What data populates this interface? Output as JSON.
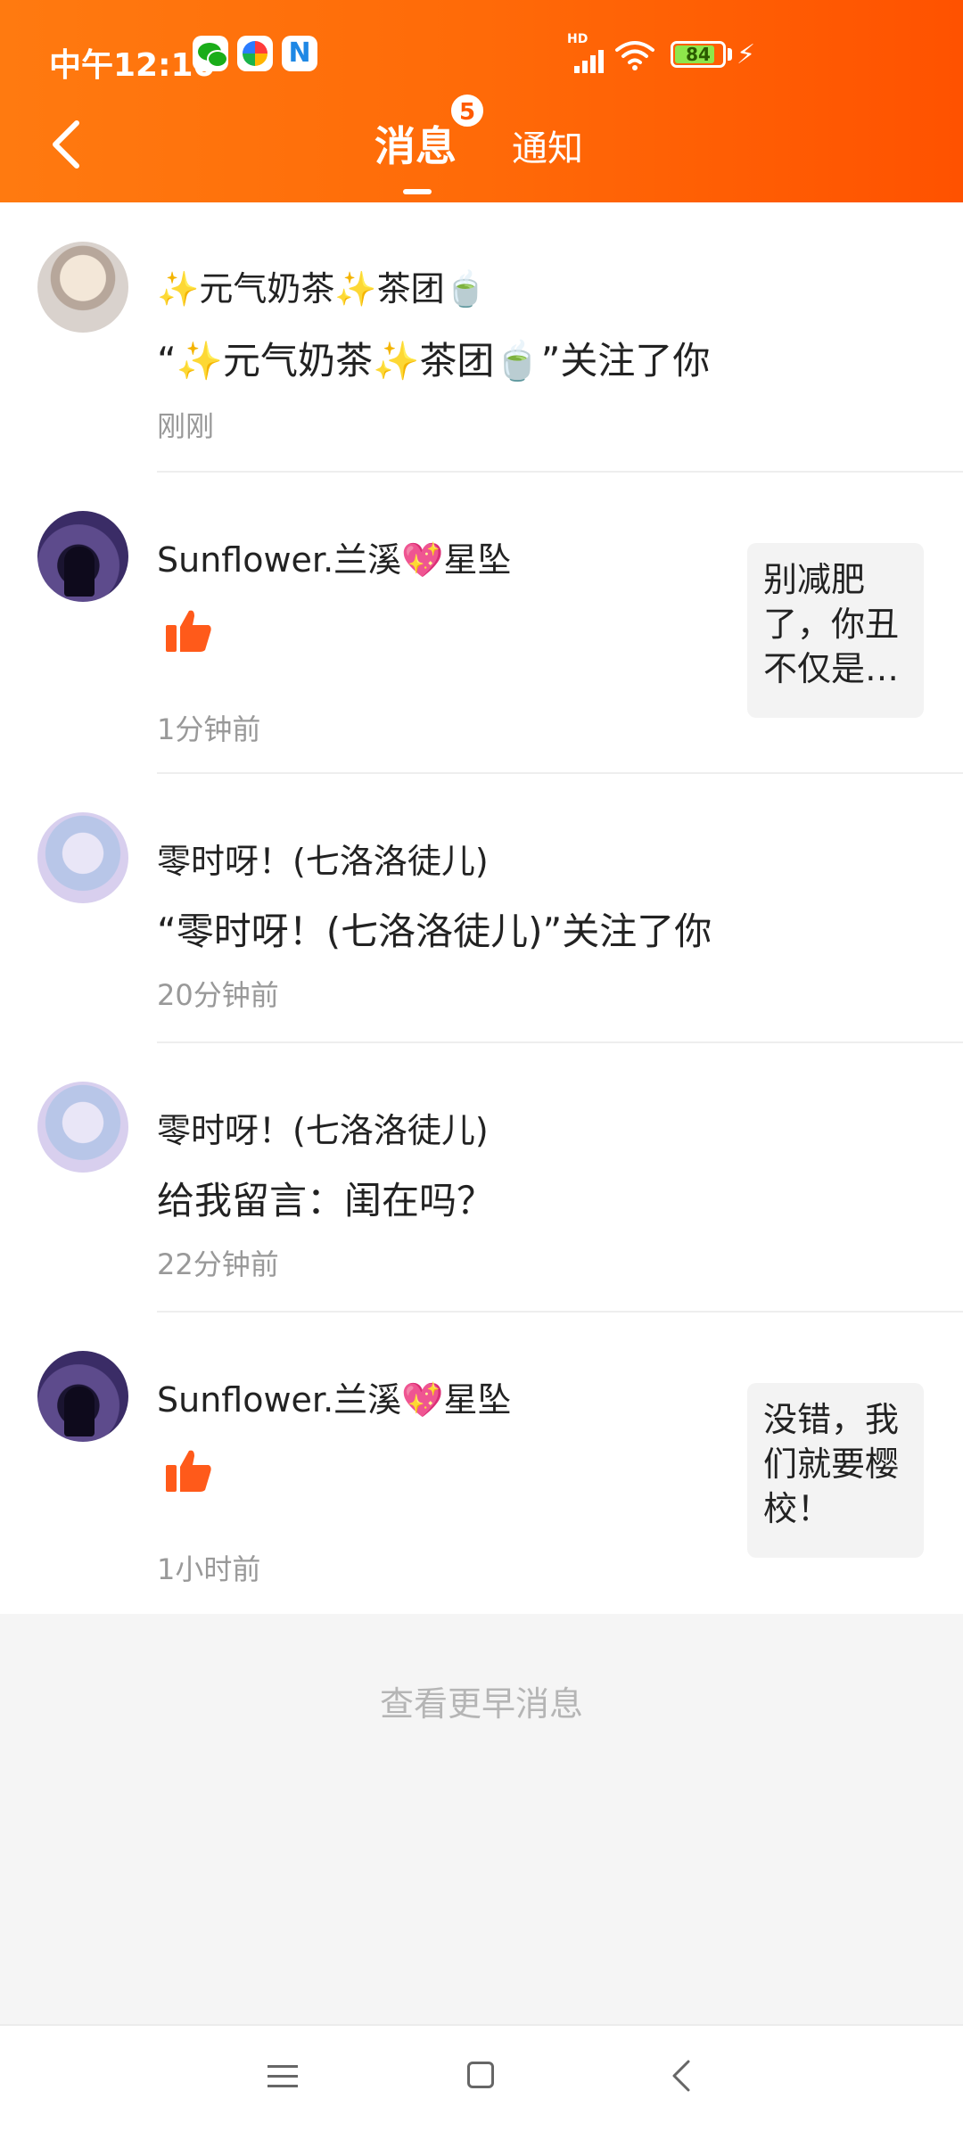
{
  "status_bar": {
    "time": "中午12:10",
    "hd": "HD",
    "battery": "84",
    "battery_level_percent": 84,
    "app_icons": [
      "wechat-icon",
      "pinwheel-icon",
      "n-app-icon"
    ]
  },
  "header": {
    "back_icon": "chevron-left-icon",
    "tabs": [
      {
        "label": "消息",
        "badge": "5",
        "active": true
      },
      {
        "label": "通知",
        "active": false
      }
    ],
    "accent_color": "#ff6a08"
  },
  "messages": [
    {
      "name": "✨元气奶茶✨茶团🍵",
      "content": "“✨元气奶茶✨茶团🍵”关注了你",
      "time": "刚刚",
      "type": "follow"
    },
    {
      "name": "Sunflower.兰溪💖星坠",
      "content": "",
      "time": "1分钟前",
      "type": "like",
      "preview": "别减肥了，你丑不仅是…"
    },
    {
      "name": "零时呀！(七洛洛徒儿)",
      "content": "“零时呀！(七洛洛徒儿)”关注了你",
      "time": "20分钟前",
      "type": "follow"
    },
    {
      "name": "零时呀！(七洛洛徒儿)",
      "content": "给我留言：闺在吗？",
      "time": "22分钟前",
      "type": "comment"
    },
    {
      "name": "Sunflower.兰溪💖星坠",
      "content": "",
      "time": "1小时前",
      "type": "like",
      "preview": "没错，我们就要樱校！"
    }
  ],
  "footer": {
    "more_label": "查看更早消息"
  },
  "navbar": {
    "icons": [
      "menu-icon",
      "home-icon",
      "back-icon"
    ]
  }
}
